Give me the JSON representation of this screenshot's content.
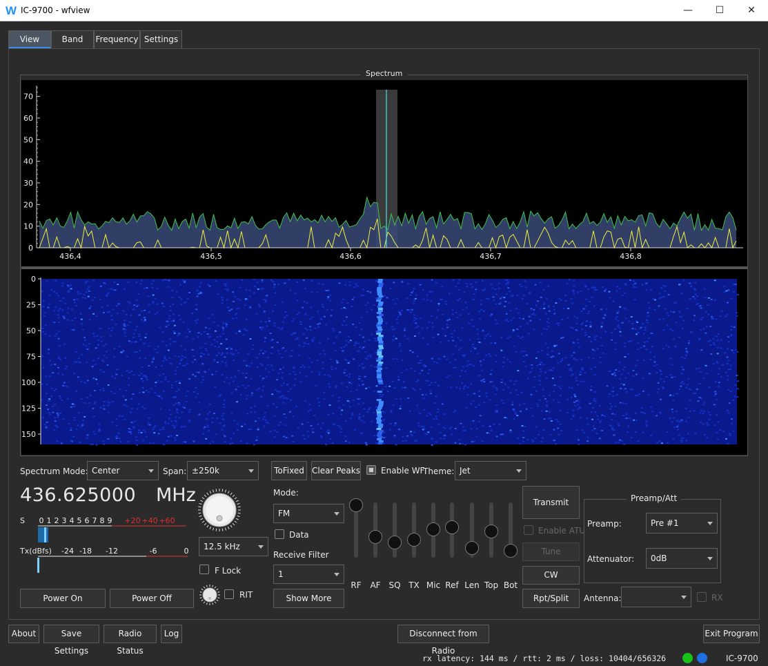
{
  "window": {
    "title": "IC-9700 - wfview",
    "logo": "W",
    "minimize": "—",
    "maximize": "☐",
    "close": "✕"
  },
  "tabs": [
    {
      "label": "View"
    },
    {
      "label": "Band"
    },
    {
      "label": "Frequency"
    },
    {
      "label": "Settings"
    }
  ],
  "spectrum": {
    "title": "Spectrum",
    "y_ticks": [
      "70",
      "60",
      "50",
      "40",
      "30",
      "20",
      "10",
      "0"
    ],
    "x_ticks": [
      "436,4",
      "436,5",
      "436,6",
      "436,7",
      "436,8"
    ],
    "wf_ticks": [
      "0",
      "25",
      "50",
      "75",
      "100",
      "125",
      "150"
    ]
  },
  "controls": {
    "spectrum_mode_label": "Spectrum Mode:",
    "spectrum_mode_value": "Center",
    "span_label": "Span:",
    "span_value": "±250k",
    "tofixed": "ToFixed",
    "clear_peaks": "Clear Peaks",
    "enable_wf": "Enable WF",
    "theme_label": "Theme:",
    "theme_value": "Jet",
    "freq": "436.625000",
    "freq_unit": "MHz",
    "step_value": "12.5 kHz",
    "flock": "F Lock",
    "rit": "RIT",
    "power_on": "Power On",
    "power_off": "Power Off",
    "mode_label": "Mode:",
    "mode_value": "FM",
    "data_label": "Data",
    "rx_filter_label": "Receive Filter",
    "rx_filter_value": "1",
    "show_more": "Show More",
    "transmit": "Transmit",
    "enable_atu": "Enable ATU",
    "tune": "Tune",
    "cw": "CW",
    "rpt_split": "Rpt/Split",
    "antenna_label": "Antenna:",
    "rx_label": "RX",
    "preamp_att_title": "Preamp/Att",
    "preamp_label": "Preamp:",
    "preamp_value": "Pre #1",
    "att_label": "Attenuator:",
    "att_value": "0dB"
  },
  "meters": {
    "s_label": "S",
    "s_scale": [
      "0",
      "1",
      "2",
      "3",
      "4",
      "5",
      "6",
      "7",
      "8",
      "9"
    ],
    "s_plus": [
      "+20",
      "+40",
      "+60"
    ],
    "tx_label": "Tx(dBfs)",
    "tx_scale": [
      "-24",
      "-18",
      "-12",
      "-6",
      "0"
    ],
    "s_level": 0.07,
    "tx_level": 0.0
  },
  "sliders": [
    {
      "label": "RF",
      "value": 0.95
    },
    {
      "label": "AF",
      "value": 0.37
    },
    {
      "label": "SQ",
      "value": 0.27
    },
    {
      "label": "TX",
      "value": 0.32
    },
    {
      "label": "Mic",
      "value": 0.51
    },
    {
      "label": "Ref",
      "value": 0.55
    },
    {
      "label": "Len",
      "value": 0.17
    },
    {
      "label": "Top",
      "value": 0.47
    },
    {
      "label": "Bot",
      "value": 0.12
    }
  ],
  "footer": {
    "about": "About",
    "save_settings": "Save Settings",
    "radio_status": "Radio Status",
    "log": "Log",
    "disconnect": "Disconnect from Radio",
    "exit": "Exit Program",
    "status": "rx latency: 144 ms / rtt:   2 ms / loss: 10404/656326",
    "radio": "IC-9700",
    "led1_color": "#19c219",
    "led2_color": "#1e6fe0"
  }
}
